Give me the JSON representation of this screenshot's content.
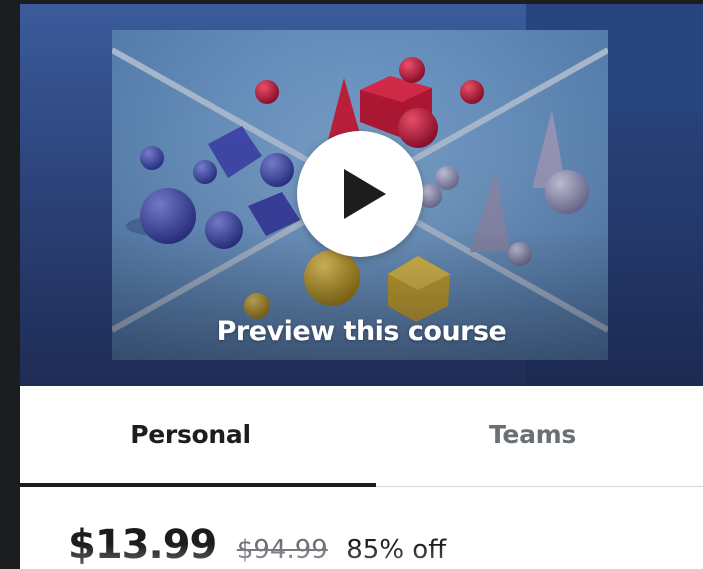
{
  "preview": {
    "label": "Preview this course",
    "play_icon": "play-icon"
  },
  "tabs": [
    {
      "label": "Personal",
      "selected": true
    },
    {
      "label": "Teams",
      "selected": false
    }
  ],
  "pricing": {
    "current_price": "$13.99",
    "original_price": "$94.99",
    "discount": "85% off"
  },
  "colors": {
    "text_primary": "#1c1d1f",
    "text_muted": "#6a6f73",
    "preview_background": "#2a3f74"
  }
}
